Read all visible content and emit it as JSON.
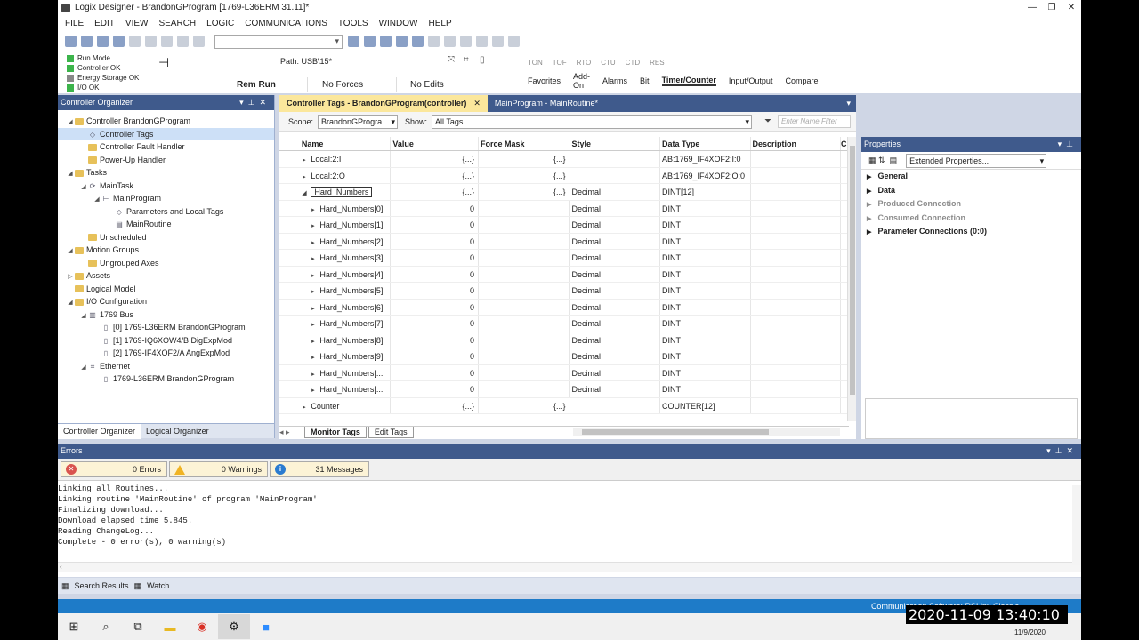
{
  "window": {
    "title": "Logix Designer - BrandonGProgram [1769-L36ERM 31.11]*",
    "controls": [
      "—",
      "❐",
      "✕"
    ]
  },
  "menu": [
    "FILE",
    "EDIT",
    "VIEW",
    "SEARCH",
    "LOGIC",
    "COMMUNICATIONS",
    "TOOLS",
    "WINDOW",
    "HELP"
  ],
  "controller_status": {
    "items": [
      "Run Mode",
      "Controller OK",
      "Energy Storage OK",
      "I/O OK"
    ],
    "path_label": "Path: USB\\15*",
    "mode": "Rem Run",
    "forces": "No Forces",
    "edits": "No Edits"
  },
  "instruction_toolbar": {
    "instructions": [
      "TON",
      "TOF",
      "RTO",
      "CTU",
      "CTD",
      "RES"
    ],
    "tabs": [
      "Favorites",
      "Add-On",
      "Alarms",
      "Bit",
      "Timer/Counter",
      "Input/Output",
      "Compare"
    ],
    "active_tab": "Timer/Counter"
  },
  "organizer": {
    "title": "Controller Organizer",
    "tree": [
      {
        "label": "Controller BrandonGProgram",
        "indent": 1,
        "icon": "folder",
        "expand": "◢"
      },
      {
        "label": "Controller Tags",
        "indent": 2,
        "icon": "tag",
        "expand": "",
        "selected": true
      },
      {
        "label": "Controller Fault Handler",
        "indent": 2,
        "icon": "folder",
        "expand": ""
      },
      {
        "label": "Power-Up Handler",
        "indent": 2,
        "icon": "folder",
        "expand": ""
      },
      {
        "label": "Tasks",
        "indent": 1,
        "icon": "folder",
        "expand": "◢"
      },
      {
        "label": "MainTask",
        "indent": 2,
        "icon": "task",
        "expand": "◢"
      },
      {
        "label": "MainProgram",
        "indent": 3,
        "icon": "program",
        "expand": "◢"
      },
      {
        "label": "Parameters and Local Tags",
        "indent": 4,
        "icon": "tag",
        "expand": ""
      },
      {
        "label": "MainRoutine",
        "indent": 4,
        "icon": "routine",
        "expand": ""
      },
      {
        "label": "Unscheduled",
        "indent": 2,
        "icon": "folder",
        "expand": ""
      },
      {
        "label": "Motion Groups",
        "indent": 1,
        "icon": "folder",
        "expand": "◢"
      },
      {
        "label": "Ungrouped Axes",
        "indent": 2,
        "icon": "folder",
        "expand": ""
      },
      {
        "label": "Assets",
        "indent": 1,
        "icon": "folder",
        "expand": "▷"
      },
      {
        "label": "Logical Model",
        "indent": 1,
        "icon": "folder",
        "expand": ""
      },
      {
        "label": "I/O Configuration",
        "indent": 1,
        "icon": "folder",
        "expand": "◢"
      },
      {
        "label": "1769 Bus",
        "indent": 2,
        "icon": "bus",
        "expand": "◢"
      },
      {
        "label": "[0] 1769-L36ERM BrandonGProgram",
        "indent": 3,
        "icon": "module",
        "expand": ""
      },
      {
        "label": "[1] 1769-IQ6XOW4/B DigExpMod",
        "indent": 3,
        "icon": "module",
        "expand": ""
      },
      {
        "label": "[2] 1769-IF4XOF2/A AngExpMod",
        "indent": 3,
        "icon": "module",
        "expand": ""
      },
      {
        "label": "Ethernet",
        "indent": 2,
        "icon": "network",
        "expand": "◢"
      },
      {
        "label": "1769-L36ERM BrandonGProgram",
        "indent": 3,
        "icon": "module",
        "expand": ""
      }
    ],
    "tabs": [
      "Controller Organizer",
      "Logical Organizer"
    ]
  },
  "document": {
    "tabs": [
      {
        "label": "Controller Tags - BrandonGProgram(controller)",
        "active": true
      },
      {
        "label": "MainProgram - MainRoutine*",
        "active": false
      }
    ],
    "scope_label": "Scope:",
    "scope_value": "BrandonGProgra",
    "show_label": "Show:",
    "show_value": "All Tags",
    "name_filter_placeholder": "Enter Name Filter",
    "columns": {
      "name": "Name",
      "value": "Value",
      "force_mask": "Force Mask",
      "style": "Style",
      "data_type": "Data Type",
      "description": "Description",
      "extra": "C"
    },
    "rows": [
      {
        "name": "Local:2:I",
        "value": "{...}",
        "force": "{...}",
        "style": "",
        "type": "AB:1769_IF4XOF2:I:0",
        "expand": "▸",
        "sub": false
      },
      {
        "name": "Local:2:O",
        "value": "{...}",
        "force": "{...}",
        "style": "",
        "type": "AB:1769_IF4XOF2:O:0",
        "expand": "▸",
        "sub": false
      },
      {
        "name": "Hard_Numbers",
        "value": "{...}",
        "force": "{...}",
        "style": "Decimal",
        "type": "DINT[12]",
        "expand": "◢",
        "sub": false,
        "edit": true
      },
      {
        "name": "Hard_Numbers[0]",
        "value": "0",
        "force": "",
        "style": "Decimal",
        "type": "DINT",
        "expand": "▸",
        "sub": true
      },
      {
        "name": "Hard_Numbers[1]",
        "value": "0",
        "force": "",
        "style": "Decimal",
        "type": "DINT",
        "expand": "▸",
        "sub": true
      },
      {
        "name": "Hard_Numbers[2]",
        "value": "0",
        "force": "",
        "style": "Decimal",
        "type": "DINT",
        "expand": "▸",
        "sub": true
      },
      {
        "name": "Hard_Numbers[3]",
        "value": "0",
        "force": "",
        "style": "Decimal",
        "type": "DINT",
        "expand": "▸",
        "sub": true
      },
      {
        "name": "Hard_Numbers[4]",
        "value": "0",
        "force": "",
        "style": "Decimal",
        "type": "DINT",
        "expand": "▸",
        "sub": true
      },
      {
        "name": "Hard_Numbers[5]",
        "value": "0",
        "force": "",
        "style": "Decimal",
        "type": "DINT",
        "expand": "▸",
        "sub": true
      },
      {
        "name": "Hard_Numbers[6]",
        "value": "0",
        "force": "",
        "style": "Decimal",
        "type": "DINT",
        "expand": "▸",
        "sub": true
      },
      {
        "name": "Hard_Numbers[7]",
        "value": "0",
        "force": "",
        "style": "Decimal",
        "type": "DINT",
        "expand": "▸",
        "sub": true
      },
      {
        "name": "Hard_Numbers[8]",
        "value": "0",
        "force": "",
        "style": "Decimal",
        "type": "DINT",
        "expand": "▸",
        "sub": true
      },
      {
        "name": "Hard_Numbers[9]",
        "value": "0",
        "force": "",
        "style": "Decimal",
        "type": "DINT",
        "expand": "▸",
        "sub": true
      },
      {
        "name": "Hard_Numbers[...",
        "value": "0",
        "force": "",
        "style": "Decimal",
        "type": "DINT",
        "expand": "▸",
        "sub": true
      },
      {
        "name": "Hard_Numbers[...",
        "value": "0",
        "force": "",
        "style": "Decimal",
        "type": "DINT",
        "expand": "▸",
        "sub": true
      },
      {
        "name": "Counter",
        "value": "{...}",
        "force": "{...}",
        "style": "",
        "type": "COUNTER[12]",
        "expand": "▸",
        "sub": false
      }
    ],
    "bottom_tabs": [
      "Monitor Tags",
      "Edit Tags"
    ]
  },
  "properties": {
    "title": "Properties",
    "view_select": "Extended Properties...",
    "categories": [
      {
        "label": "General",
        "dim": false
      },
      {
        "label": "Data",
        "dim": false
      },
      {
        "label": "Produced Connection",
        "dim": true
      },
      {
        "label": "Consumed Connection",
        "dim": true
      },
      {
        "label": "Parameter Connections (0:0)",
        "dim": false
      }
    ]
  },
  "errors": {
    "title": "Errors",
    "errors_count": "0 Errors",
    "warnings_count": "0 Warnings",
    "messages_count": "31 Messages",
    "log": [
      "Linking all Routines...",
      "Linking routine 'MainRoutine' of program 'MainProgram'",
      "Finalizing download...",
      "Download elapsed time 5.845.",
      "Reading ChangeLog...",
      "Complete - 0 error(s), 0 warning(s)"
    ]
  },
  "bottom_panel_tabs": [
    "Search Results",
    "Watch"
  ],
  "statusbar": {
    "text": "Communication Software: RSLinx Classic"
  },
  "overlay_clock": "2020-11-09  13:40:10",
  "taskbar": {
    "date": "11/9/2020"
  }
}
